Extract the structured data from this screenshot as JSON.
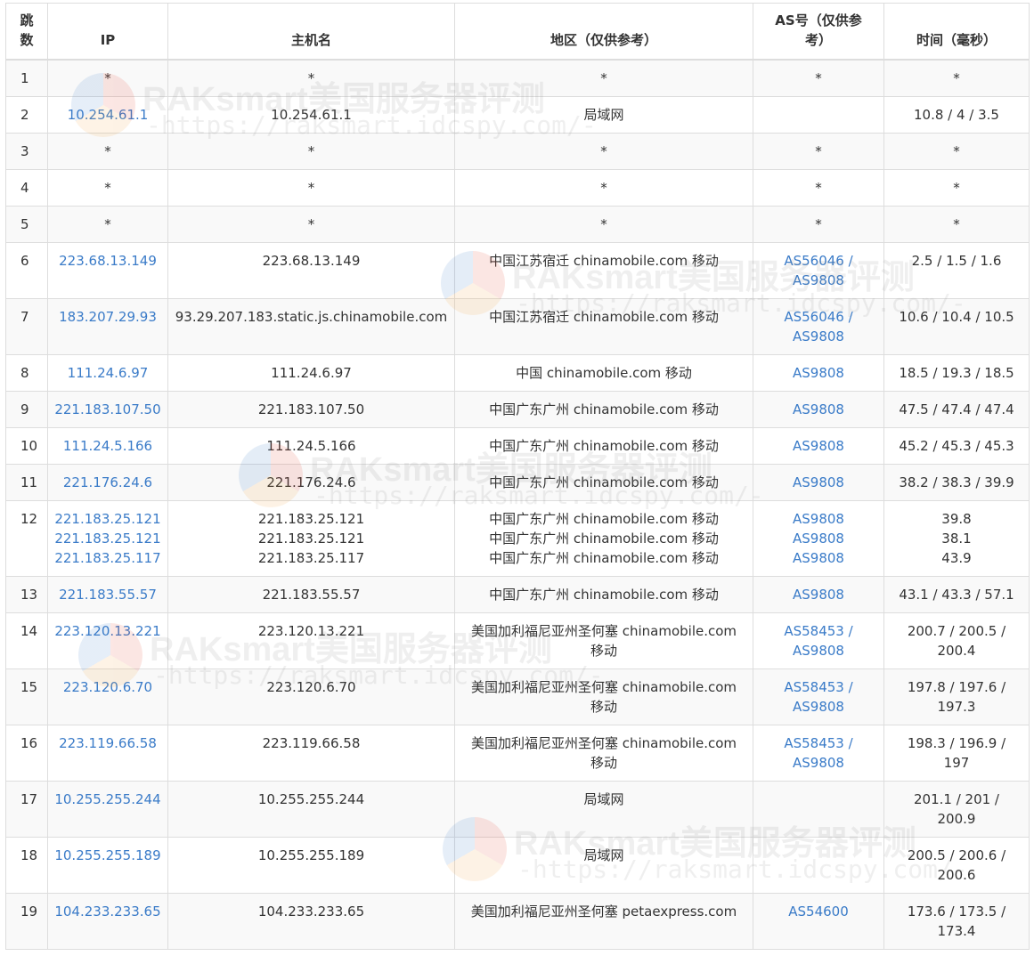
{
  "headers": {
    "hop": "跳数",
    "ip": "IP",
    "host": "主机名",
    "region": "地区（仅供参考）",
    "asn": "AS号（仅供参考）",
    "time": "时间（毫秒）"
  },
  "watermark": {
    "title": "RAKsmart美国服务器评测",
    "url": "-https://raksmart.idcspy.com/-"
  },
  "rows": [
    {
      "hop": "1",
      "ip": [
        "*"
      ],
      "ip_link": false,
      "host": [
        "*"
      ],
      "region": [
        "*"
      ],
      "asn": [
        "*"
      ],
      "asn_link": false,
      "time": [
        "*"
      ]
    },
    {
      "hop": "2",
      "ip": [
        "10.254.61.1"
      ],
      "ip_link": true,
      "host": [
        "10.254.61.1"
      ],
      "region": [
        "局域网"
      ],
      "asn": [
        ""
      ],
      "asn_link": false,
      "time": [
        "10.8 / 4 / 3.5"
      ]
    },
    {
      "hop": "3",
      "ip": [
        "*"
      ],
      "ip_link": false,
      "host": [
        "*"
      ],
      "region": [
        "*"
      ],
      "asn": [
        "*"
      ],
      "asn_link": false,
      "time": [
        "*"
      ]
    },
    {
      "hop": "4",
      "ip": [
        "*"
      ],
      "ip_link": false,
      "host": [
        "*"
      ],
      "region": [
        "*"
      ],
      "asn": [
        "*"
      ],
      "asn_link": false,
      "time": [
        "*"
      ]
    },
    {
      "hop": "5",
      "ip": [
        "*"
      ],
      "ip_link": false,
      "host": [
        "*"
      ],
      "region": [
        "*"
      ],
      "asn": [
        "*"
      ],
      "asn_link": false,
      "time": [
        "*"
      ]
    },
    {
      "hop": "6",
      "ip": [
        "223.68.13.149"
      ],
      "ip_link": true,
      "host": [
        "223.68.13.149"
      ],
      "region": [
        "中国江苏宿迁 chinamobile.com 移动"
      ],
      "asn": [
        "AS56046 /",
        "AS9808"
      ],
      "asn_link": true,
      "time": [
        "2.5 / 1.5 / 1.6"
      ]
    },
    {
      "hop": "7",
      "ip": [
        "183.207.29.93"
      ],
      "ip_link": true,
      "host": [
        "93.29.207.183.static.js.chinamobile.com"
      ],
      "region": [
        "中国江苏宿迁 chinamobile.com 移动"
      ],
      "asn": [
        "AS56046 /",
        "AS9808"
      ],
      "asn_link": true,
      "time": [
        "10.6 / 10.4 / 10.5"
      ]
    },
    {
      "hop": "8",
      "ip": [
        "111.24.6.97"
      ],
      "ip_link": true,
      "host": [
        "111.24.6.97"
      ],
      "region": [
        "中国 chinamobile.com 移动"
      ],
      "asn": [
        "AS9808"
      ],
      "asn_link": true,
      "time": [
        "18.5 / 19.3 / 18.5"
      ]
    },
    {
      "hop": "9",
      "ip": [
        "221.183.107.50"
      ],
      "ip_link": true,
      "host": [
        "221.183.107.50"
      ],
      "region": [
        "中国广东广州 chinamobile.com 移动"
      ],
      "asn": [
        "AS9808"
      ],
      "asn_link": true,
      "time": [
        "47.5 / 47.4 / 47.4"
      ]
    },
    {
      "hop": "10",
      "ip": [
        "111.24.5.166"
      ],
      "ip_link": true,
      "host": [
        "111.24.5.166"
      ],
      "region": [
        "中国广东广州 chinamobile.com 移动"
      ],
      "asn": [
        "AS9808"
      ],
      "asn_link": true,
      "time": [
        "45.2 / 45.3 / 45.3"
      ]
    },
    {
      "hop": "11",
      "ip": [
        "221.176.24.6"
      ],
      "ip_link": true,
      "host": [
        "221.176.24.6"
      ],
      "region": [
        "中国广东广州 chinamobile.com 移动"
      ],
      "asn": [
        "AS9808"
      ],
      "asn_link": true,
      "time": [
        "38.2 / 38.3 / 39.9"
      ]
    },
    {
      "hop": "12",
      "ip": [
        "221.183.25.121",
        "221.183.25.121",
        "221.183.25.117"
      ],
      "ip_link": true,
      "host": [
        "221.183.25.121",
        "221.183.25.121",
        "221.183.25.117"
      ],
      "region": [
        "中国广东广州 chinamobile.com 移动",
        "中国广东广州 chinamobile.com 移动",
        "中国广东广州 chinamobile.com 移动"
      ],
      "asn": [
        "AS9808",
        "AS9808",
        "AS9808"
      ],
      "asn_link": true,
      "time": [
        "39.8",
        "38.1",
        "43.9"
      ]
    },
    {
      "hop": "13",
      "ip": [
        "221.183.55.57"
      ],
      "ip_link": true,
      "host": [
        "221.183.55.57"
      ],
      "region": [
        "中国广东广州 chinamobile.com 移动"
      ],
      "asn": [
        "AS9808"
      ],
      "asn_link": true,
      "time": [
        "43.1 / 43.3 / 57.1"
      ]
    },
    {
      "hop": "14",
      "ip": [
        "223.120.13.221"
      ],
      "ip_link": true,
      "host": [
        "223.120.13.221"
      ],
      "region": [
        "美国加利福尼亚州圣何塞 chinamobile.com",
        "移动"
      ],
      "asn": [
        "AS58453 /",
        "AS9808"
      ],
      "asn_link": true,
      "time": [
        "200.7 / 200.5 /",
        "200.4"
      ]
    },
    {
      "hop": "15",
      "ip": [
        "223.120.6.70"
      ],
      "ip_link": true,
      "host": [
        "223.120.6.70"
      ],
      "region": [
        "美国加利福尼亚州圣何塞 chinamobile.com",
        "移动"
      ],
      "asn": [
        "AS58453 /",
        "AS9808"
      ],
      "asn_link": true,
      "time": [
        "197.8 / 197.6 /",
        "197.3"
      ]
    },
    {
      "hop": "16",
      "ip": [
        "223.119.66.58"
      ],
      "ip_link": true,
      "host": [
        "223.119.66.58"
      ],
      "region": [
        "美国加利福尼亚州圣何塞 chinamobile.com",
        "移动"
      ],
      "asn": [
        "AS58453 /",
        "AS9808"
      ],
      "asn_link": true,
      "time": [
        "198.3 / 196.9 /",
        "197"
      ]
    },
    {
      "hop": "17",
      "ip": [
        "10.255.255.244"
      ],
      "ip_link": true,
      "host": [
        "10.255.255.244"
      ],
      "region": [
        "局域网"
      ],
      "asn": [
        ""
      ],
      "asn_link": false,
      "time": [
        "201.1 / 201 /",
        "200.9"
      ]
    },
    {
      "hop": "18",
      "ip": [
        "10.255.255.189"
      ],
      "ip_link": true,
      "host": [
        "10.255.255.189"
      ],
      "region": [
        "局域网"
      ],
      "asn": [
        ""
      ],
      "asn_link": false,
      "time": [
        "200.5 / 200.6 /",
        "200.6"
      ]
    },
    {
      "hop": "19",
      "ip": [
        "104.233.233.65"
      ],
      "ip_link": true,
      "host": [
        "104.233.233.65"
      ],
      "region": [
        "美国加利福尼亚州圣何塞 petaexpress.com"
      ],
      "asn": [
        "AS54600"
      ],
      "asn_link": true,
      "time": [
        "173.6 / 173.5 /",
        "173.4"
      ]
    }
  ]
}
